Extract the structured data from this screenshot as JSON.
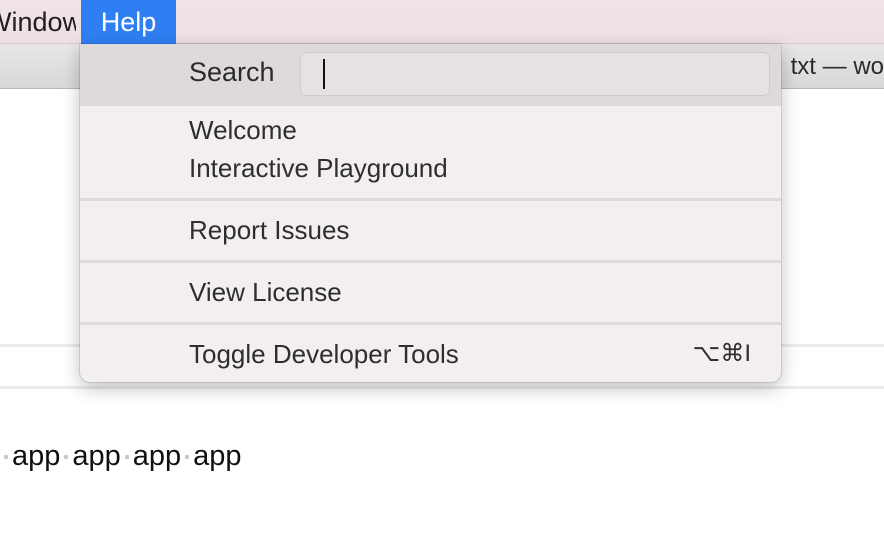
{
  "menubar": {
    "window_label": "Window",
    "help_label": "Help"
  },
  "titlebar": {
    "title_fragment": "txt — wo"
  },
  "editor": {
    "tokens": [
      "app",
      "app",
      "app",
      "app"
    ]
  },
  "help_menu": {
    "search_label": "Search",
    "search_value": "",
    "items": [
      {
        "label": "Welcome"
      },
      {
        "label": "Interactive Playground"
      },
      {
        "label": "Report Issues"
      },
      {
        "label": "View License"
      },
      {
        "label": "Toggle Developer Tools",
        "shortcut": "⌥⌘I"
      }
    ]
  },
  "colors": {
    "menubar_bg": "#f1e4e6",
    "highlight": "#2f7ff2",
    "menu_bg": "#f3efef",
    "search_row_bg": "#dedad9"
  }
}
